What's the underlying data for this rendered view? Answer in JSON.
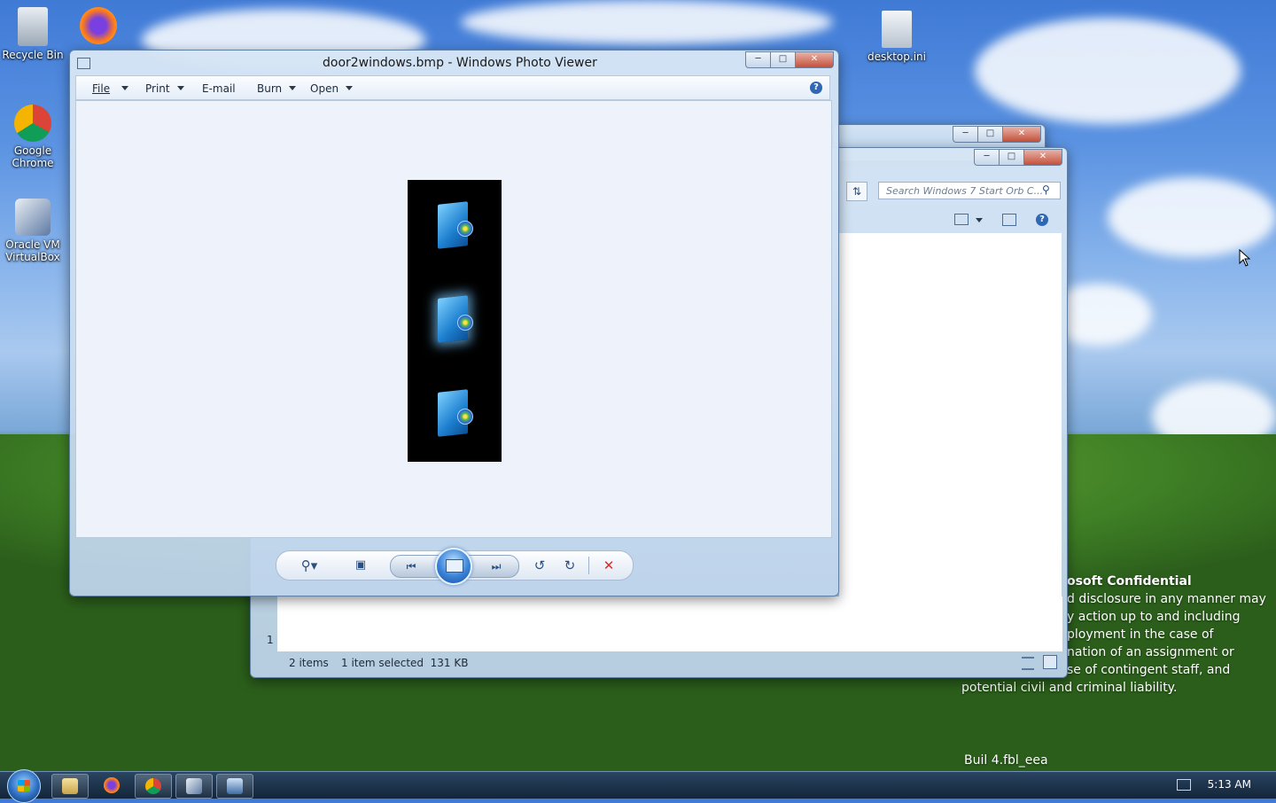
{
  "desktop": {
    "icons": [
      {
        "label": "Recycle Bin"
      },
      {
        "label": "Google\nChrome"
      },
      {
        "label": "Oracle VM\nVirtualBox"
      },
      {
        "label": "desktop.ini"
      }
    ],
    "watermark": {
      "lines": [
        "osoft Confidential",
        "d disclosure in any manner may",
        "y action up to and including",
        "ployment in the case of",
        "nation of an assignment or",
        "se of contingent staff, and",
        "potential civil and criminal liability."
      ],
      "build_line": "Buil          4.fbl_eea"
    }
  },
  "explorer": {
    "search_placeholder": "Search Windows 7 Start Orb C...",
    "status": {
      "items": "2 items",
      "selected": "1 item selected  131 KB"
    },
    "left_fragment": "1"
  },
  "photo_viewer": {
    "title": "door2windows.bmp - Windows Photo Viewer",
    "menu": [
      {
        "label": "File",
        "has_dropdown": true
      },
      {
        "label": "Print",
        "has_dropdown": true
      },
      {
        "label": "E-mail",
        "has_dropdown": false
      },
      {
        "label": "Burn",
        "has_dropdown": true
      },
      {
        "label": "Open",
        "has_dropdown": true
      }
    ],
    "controls": [
      "zoom-icon",
      "fit-window-icon",
      "previous-icon",
      "slideshow-icon",
      "next-icon",
      "rotate-ccw-icon",
      "rotate-cw-icon",
      "delete-icon"
    ]
  },
  "taskbar": {
    "clock": "5:13 AM",
    "items": [
      "explorer-icon",
      "firefox-icon",
      "chrome-icon",
      "virtualbox-icon",
      "photo-viewer-icon"
    ]
  },
  "colors": {
    "close_button": "#c4503a",
    "delete": "#d32f2f",
    "accent": "#2b5c9a"
  }
}
